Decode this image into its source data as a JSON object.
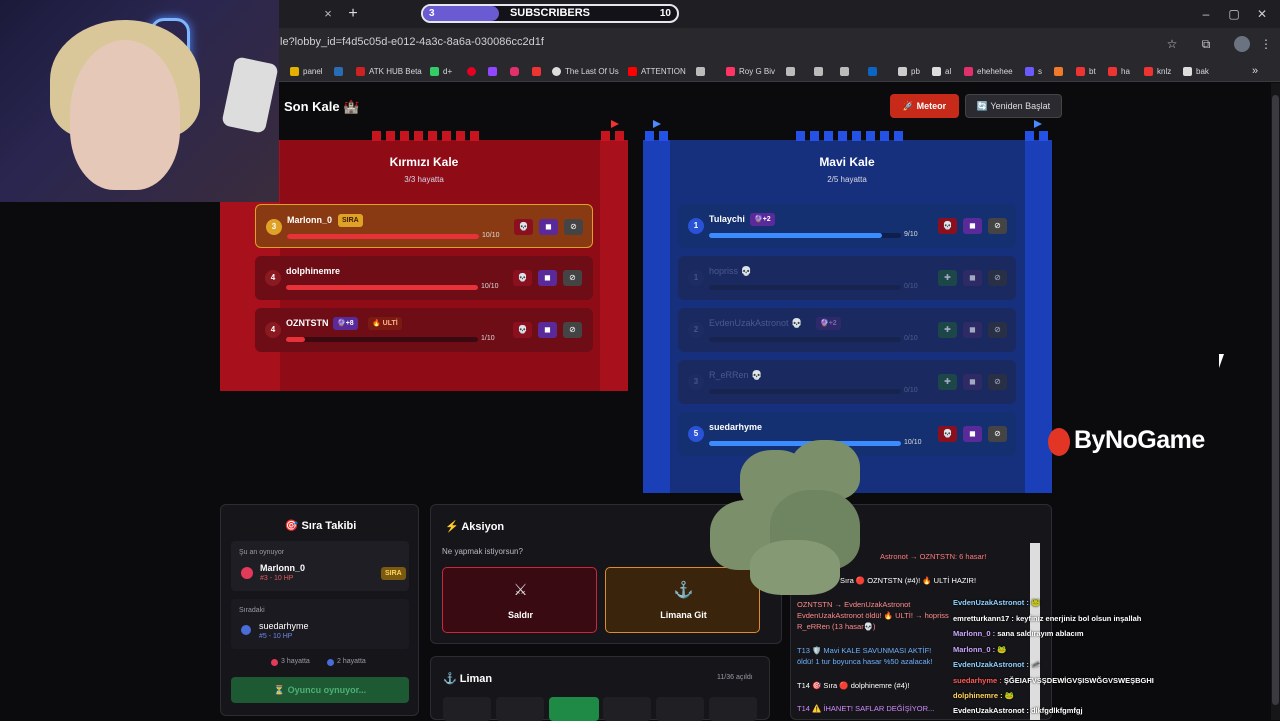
{
  "browser": {
    "tab_close": "×",
    "tab_new": "+",
    "url": "le?lobby_id=f4d5c05d-e012-4a3c-8a6a-030086cc2d1f",
    "window": {
      "minimize": "–",
      "maximize": "▢",
      "close": "✕"
    },
    "bookmarks": [
      "panel",
      "ATK HUB Beta",
      "d+",
      "The Last Of Us",
      "ATTENTION",
      "Roy G Biv",
      "pb",
      "al",
      "ehehehee",
      "s",
      "bt",
      "ha",
      "knlz",
      "bak"
    ]
  },
  "subscribers": {
    "label": "SUBSCRIBERS",
    "current": "3",
    "goal": "10",
    "progress": 0.3
  },
  "page": {
    "title": "Son Kale 🏰",
    "meteor_button": "🚀 Meteor",
    "restart_button": "🔄 Yeniden Başlat"
  },
  "red_castle": {
    "title": "Kırmızı Kale",
    "subtitle": "3/3 hayatta",
    "players": [
      {
        "num": "3",
        "name": "Marlonn_0",
        "badge": "SIRA",
        "hp": "10/10",
        "fill": 1.0
      },
      {
        "num": "4",
        "name": "dolphinemre",
        "hp": "10/10",
        "fill": 1.0
      },
      {
        "num": "4",
        "name": "OZNTSTN",
        "badge": "🔮+8",
        "badge2": "🔥 ULTİ",
        "hp": "1/10",
        "fill": 0.1
      }
    ]
  },
  "blue_castle": {
    "title": "Mavi Kale",
    "subtitle": "2/5 hayatta",
    "players": [
      {
        "num": "1",
        "name": "Tulaychi",
        "badge": "🔮+2",
        "hp": "9/10",
        "fill": 0.9
      },
      {
        "num": "1",
        "name": "hopriss 💀",
        "hp": "0/10",
        "fill": 0
      },
      {
        "num": "2",
        "name": "EvdenUzakAstronot 💀",
        "badge": "🔮+2",
        "hp": "0/10",
        "fill": 0
      },
      {
        "num": "3",
        "name": "R_eRRen 💀",
        "hp": "0/10",
        "fill": 0
      },
      {
        "num": "5",
        "name": "suedarhyme",
        "hp": "10/10",
        "fill": 1.0
      }
    ]
  },
  "logo": {
    "text": "ByNoGame"
  },
  "turn_panel": {
    "title": "🎯 Sıra Takibi",
    "now_playing_label": "Şu an oynuyor",
    "now_name": "Marlonn_0",
    "now_sub": "#3 - 10 HP",
    "now_badge": "SIRA",
    "next_label": "Sıradaki",
    "next_name": "suedarhyme",
    "next_sub": "#5 - 10 HP",
    "red_alive": "3 hayatta",
    "blue_alive": "2 hayatta",
    "wait_button": "⏳ Oyuncu oynuyor..."
  },
  "action_panel": {
    "title": "⚡ Aksiyon",
    "question": "Ne yapmak istiyorsun?",
    "attack": "Saldır",
    "harbor": "Limana Git"
  },
  "harbor_panel": {
    "title": "⚓ Liman",
    "count": "11/36 açıldı"
  },
  "log": [
    "Astronot → OZNTSTN: 6 hasar!",
    "Sıra 🔴 OZNTSTN (#4)! 🔥 ULTİ HAZIR!",
    "OZNTSTN → EvdenUzakAstronot",
    "EvdenUzakAstronot öldü! 🔥 ULTİ! → hopriss",
    "R_eRRen (13 hasar💀)",
    "T13 🛡️ Mavi KALE SAVUNMASI AKTİF!",
    "öldü! 1 tur boyunca hasar %50 azalacak!",
    "T14 🎯 Sıra 🔴 dolphinemre (#4)!",
    "T14 ⚠️ İHANET! SAFLAR DEĞİŞİYOR..."
  ],
  "chat": [
    {
      "user": "EvdenUzakAstronot :",
      "msg": "🐸",
      "color": "#8fd0ff"
    },
    {
      "user": "emretturkann17 :",
      "msg": "keyfiniz enerjiniz bol olsun inşallah",
      "color": "#ffffff"
    },
    {
      "user": "Marlonn_0 :",
      "msg": "sana saldırayım ablacım",
      "color": "#c9a6ff"
    },
    {
      "user": "Marlonn_0 :",
      "msg": "🐸",
      "color": "#c9a6ff"
    },
    {
      "user": "EvdenUzakAstronot :",
      "msg": "🦟",
      "color": "#8fd0ff"
    },
    {
      "user": "suedarhyme :",
      "msg": "ŞĞEIAFVSŞDEWİGVŞISWĞGVSWEŞBGHI",
      "color": "#ff5a5a"
    },
    {
      "user": "dolphinemre :",
      "msg": "🐸",
      "color": "#ffd35a"
    },
    {
      "user": "EvdenUzakAstronot :",
      "msg": "dlkfgdlkfgmfgj",
      "color": "#ffffff"
    }
  ]
}
